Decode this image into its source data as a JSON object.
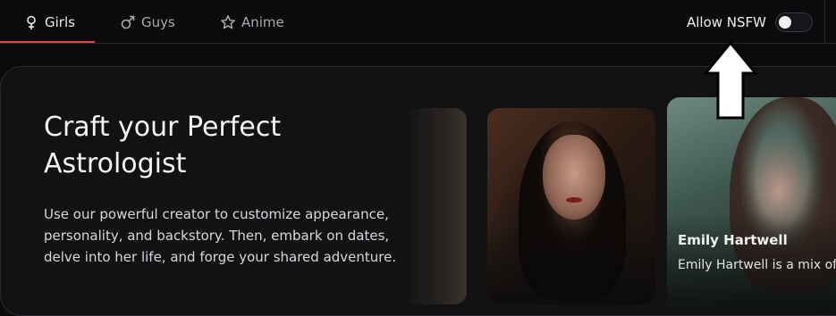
{
  "nav": {
    "tabs": [
      {
        "label": "Girls",
        "icon": "female-symbol-icon",
        "active": true
      },
      {
        "label": "Guys",
        "icon": "male-symbol-icon",
        "active": false
      },
      {
        "label": "Anime",
        "icon": "star-icon",
        "active": false
      }
    ],
    "nsfw_label": "Allow NSFW",
    "nsfw_enabled": false
  },
  "hero": {
    "title": "Craft your Perfect Astrologist",
    "description": "Use our powerful creator to customize appearance, personality, and backstory. Then, embark on dates, delve into her life, and forge your shared adventure."
  },
  "cards": [
    {
      "name": "Emily Hartwell",
      "description": "Emily Hartwell is a mix of"
    }
  ],
  "colors": {
    "accent": "#e0484b",
    "background": "#0b0b0d",
    "card": "#121215"
  }
}
